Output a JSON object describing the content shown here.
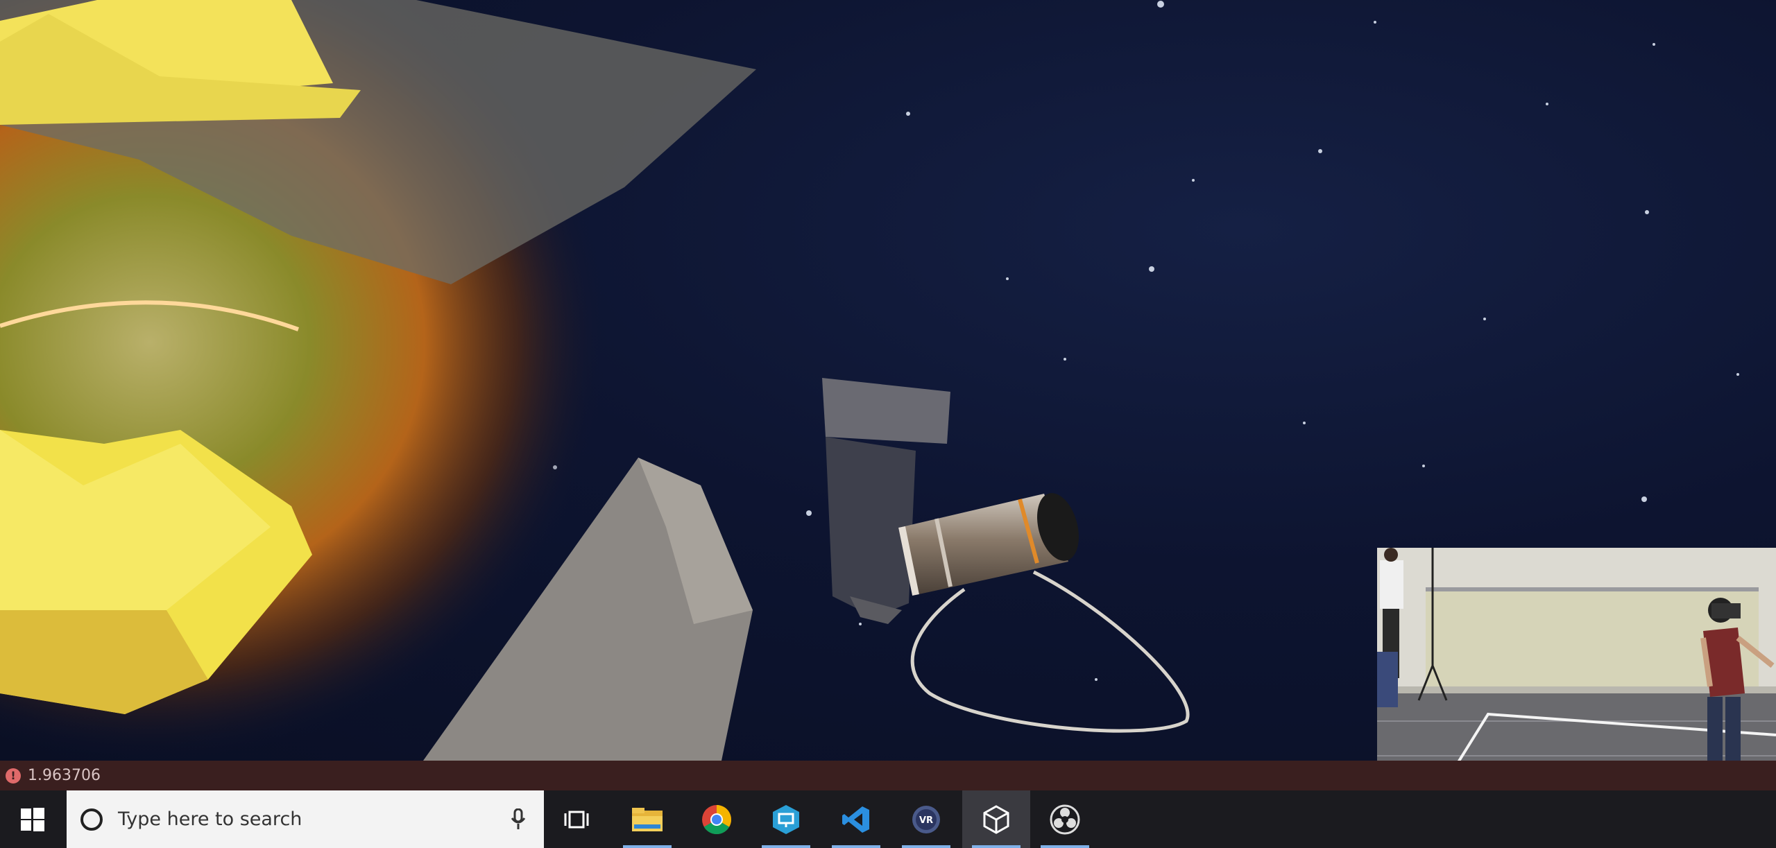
{
  "status_strip": {
    "warning_icon": "warning-circle-icon",
    "value": "1.963706"
  },
  "taskbar": {
    "search_placeholder": "Type here to search",
    "icons": [
      {
        "name": "start-windows-icon"
      },
      {
        "name": "microphone-icon"
      },
      {
        "name": "task-view-icon"
      },
      {
        "name": "file-explorer-icon"
      },
      {
        "name": "chrome-icon"
      },
      {
        "name": "remote-desktop-icon"
      },
      {
        "name": "visual-studio-code-icon"
      },
      {
        "name": "vr-app-icon"
      },
      {
        "name": "unity-icon"
      },
      {
        "name": "obs-studio-icon"
      }
    ],
    "colors": {
      "taskbar_bg": "#1b1b1f",
      "search_bg": "#f3f3f3",
      "active_underline": "#7fb0e8"
    }
  },
  "scene": {
    "colors": {
      "space": "#0d1430",
      "explosion_yellow": "#f2e14a",
      "explosion_orange": "#e07a1e",
      "hull_grey": "#8c8884"
    }
  }
}
